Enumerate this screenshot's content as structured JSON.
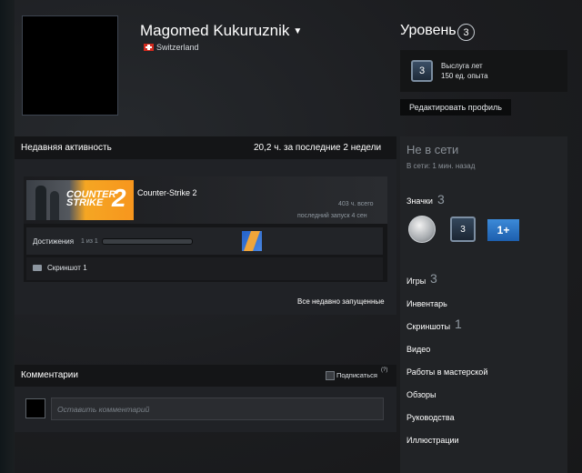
{
  "profile": {
    "name": "Magomed Kukuruznik",
    "country": "Switzerland"
  },
  "level": {
    "title": "Уровень",
    "value": "3"
  },
  "xp": {
    "badge_level": "3",
    "line1": "Выслуга лет",
    "line2": "150 ед. опыта"
  },
  "edit_profile_label": "Редактировать профиль",
  "recent_activity": {
    "title": "Недавняя активность",
    "hours": "20,2 ч. за последние 2 недели",
    "game": {
      "name": "Counter-Strike 2",
      "total": "403 ч. всего",
      "last_played": "последний запуск 4 сен",
      "logo_line1": "COUNTER",
      "logo_line2": "STRIKE",
      "logo_number": "2"
    },
    "achievements_label": "Достижения",
    "achievements_count": "1 из 1",
    "screenshot_label": "Скриншот 1",
    "all_recent": "Все недавно запущенные"
  },
  "comments": {
    "title": "Комментарии",
    "subscribe_label": "Подписаться",
    "help_marker": "(?)",
    "placeholder": "Оставить комментарий"
  },
  "sidebar": {
    "status": "Не в сети",
    "status_sub": "В сети: 1 мин. назад",
    "badges_title": "Значки",
    "badges_count": "3",
    "badge_level": "3",
    "badge_1p": "1+",
    "links": [
      {
        "label": "Игры",
        "count": "3"
      },
      {
        "label": "Инвентарь",
        "count": ""
      },
      {
        "label": "Скриншоты",
        "count": "1"
      },
      {
        "label": "Видео",
        "count": ""
      },
      {
        "label": "Работы в мастерской",
        "count": ""
      },
      {
        "label": "Обзоры",
        "count": ""
      },
      {
        "label": "Руководства",
        "count": ""
      },
      {
        "label": "Иллюстрации",
        "count": ""
      }
    ]
  }
}
